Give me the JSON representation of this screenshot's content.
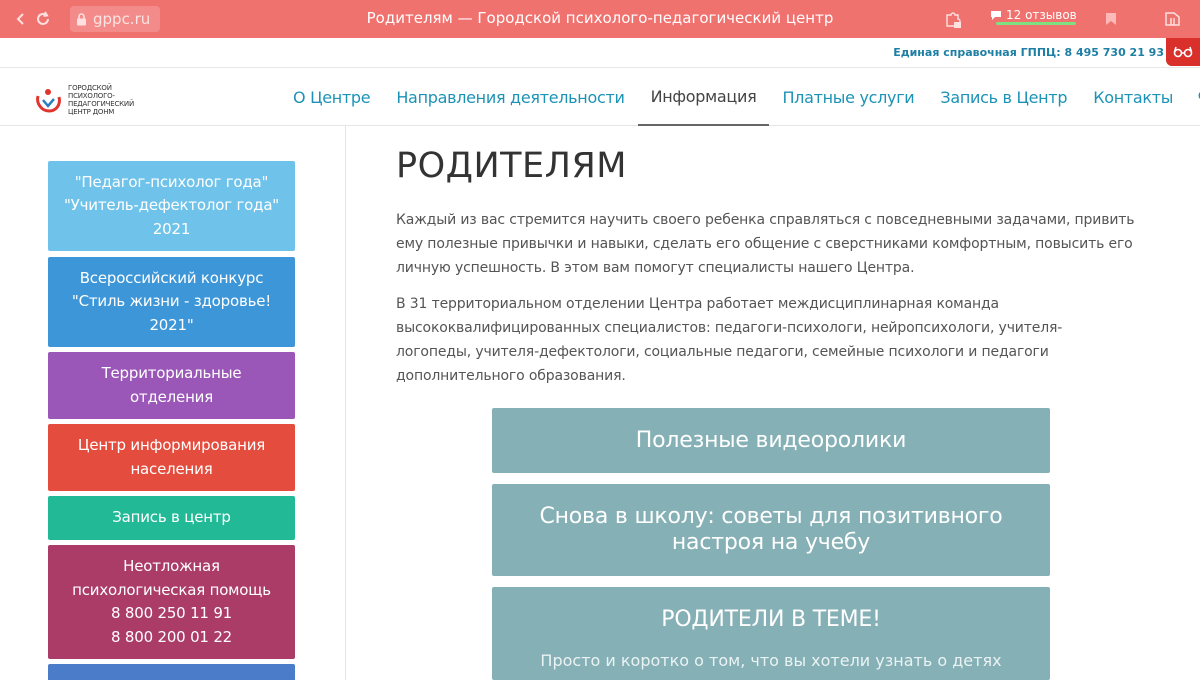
{
  "browser": {
    "url": "gppc.ru",
    "tab_title": "Родителям — Городской психолого-педагогический центр",
    "reviews": "12 отзывов"
  },
  "info_strip": {
    "phone": "Единая справочная ГППЦ: 8 495 730 21 93"
  },
  "logo": {
    "lines": [
      "Городской",
      "психолого-",
      "педагогический",
      "центр ДОНМ"
    ]
  },
  "nav": {
    "items": [
      {
        "label": "О Центре"
      },
      {
        "label": "Направления деятельности"
      },
      {
        "label": "Информация"
      },
      {
        "label": "Платные услуги"
      },
      {
        "label": "Запись в Центр"
      },
      {
        "label": "Контакты"
      }
    ],
    "active_index": 2
  },
  "sidebar": {
    "items": [
      {
        "lines": [
          "\"Педагог-психолог года\"",
          "\"Учитель-дефектолог года\"",
          "2021"
        ],
        "color": "#6fc3ea"
      },
      {
        "lines": [
          "Всероссийский конкурс",
          "\"Стиль жизни - здоровье!",
          "2021\""
        ],
        "color": "#3d96d8"
      },
      {
        "lines": [
          "Территориальные",
          "отделения"
        ],
        "color": "#9a57b8"
      },
      {
        "lines": [
          "Центр информирования",
          "населения"
        ],
        "color": "#e44c3d"
      },
      {
        "lines": [
          "Запись в центр"
        ],
        "color": "#22b996"
      },
      {
        "lines": [
          "Неотложная",
          "психологическая помощь",
          "8 800 250 11 91",
          "8 800 200 01 22"
        ],
        "color": "#ab3c68"
      },
      {
        "lines": [],
        "color": "#4a7cc9"
      }
    ]
  },
  "main": {
    "title": "РОДИТЕЛЯМ",
    "paragraphs": [
      "Каждый из вас стремится научить своего ребенка справляться с повседневными задачами, привить ему полезные привычки и навыки, сделать его общение с сверстниками комфортным, повысить его личную успешность. В этом вам помогут специалисты нашего Центра.",
      "В 31 территориальном отделении Центра работает междисциплинарная команда высококвалифицированных специалистов: педагоги-психологи, нейропсихологи, учителя-логопеды, учителя-дефектологи, социальные педагоги, семейные психологи и педагоги дополнительного образования."
    ],
    "cards": [
      {
        "title": "Полезные видеоролики",
        "subtitle": ""
      },
      {
        "title": "Снова в школу: советы для позитивного настроя на учебу",
        "subtitle": ""
      },
      {
        "title": "РОДИТЕЛИ В ТЕМЕ!",
        "subtitle": "Просто и коротко о том, что вы хотели узнать о детях"
      }
    ]
  },
  "colors": {
    "browser_bar": "#f0726f",
    "link": "#1c93b6",
    "card": "#85b0b5"
  }
}
